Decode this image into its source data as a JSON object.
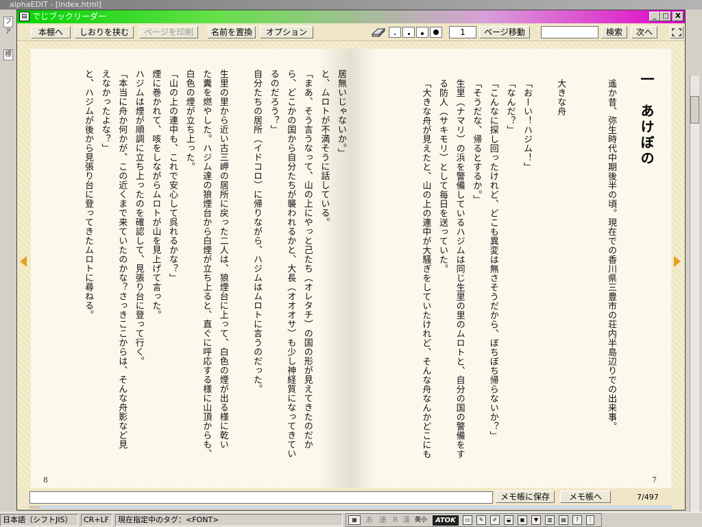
{
  "background_editor": {
    "title": "alphaEDIT - [index.html]",
    "left_marks": [
      "ファ",
      "標"
    ]
  },
  "window": {
    "title": "でじブックリーダー",
    "controls": {
      "minimize": "_",
      "maximize": "□",
      "close": "X"
    }
  },
  "toolbar": {
    "bookshelf": "本棚へ",
    "bookmark": "しおりを挟む",
    "print": "ページを印刷",
    "replace_name": "名前を置換",
    "options": "オプション",
    "page_input": "1",
    "page_move": "ページ移動",
    "search_input": "",
    "search": "検索",
    "next": "次へ",
    "dot_sizes": [
      "・",
      "・",
      "•",
      "●"
    ]
  },
  "book": {
    "right_page": {
      "number": "7",
      "chapter_title": "一　あけぼの",
      "lines": [
        "遙か昔、弥生時代中期後半の頃。現在での香川県三豊市の荘内半島辺りでの出来事。",
        "",
        "",
        "大きな舟",
        "",
        "「おーい！ハジム！」",
        "「なんだ？」",
        "「こんなに探し回ったけれど、どこも異変は無さそうだから、ぼちぼち帰らないか？」",
        "「そうだな、帰るとするか。」",
        "生里（ナマリ）の浜を警備しているハジムは同じ生里の里のムロトと、自分の国の警備をす",
        "る防人（サキモリ）として毎日を送っていた。",
        "「大きな舟が見えたと、山の上の連中が大騒ぎをしていたけれど、そんな舟なんかどこにも"
      ]
    },
    "left_page": {
      "number": "8",
      "lines": [
        "居無いじゃないか。」",
        "と、ムロトが不満そうに話している。",
        "「まあ、そう言うなって、山の上にやっと己たち（オレタチ）の国の形が見えてきたのだか",
        "ら、どこかの国から自分たちが襲われるかと、大長（オオオサ）も少し神経質になってきてい",
        "るのだろう？」",
        "自分たちの居所（イドコロ）に帰りながら、ハジムはムロトに言うのだった。",
        "",
        "生里の里から近い古三岬の居所に戻った二人は、狼煙台に上って、白色の煙が出る様に乾い",
        "た糞を燃やした。ハジム達の狼煙台から白煙が立ち上ると、直ぐに呼応する様に山頂からも、",
        "白色の煙が立ち上った。",
        "「山の上の連中も、これで安心して呉れるかな？」",
        "煙に巻かれて、咳をしながらムロトが山を見上げて言った。",
        "ハジムは煙が順調に立ち上ったのを確認して、見張り台に登って行く。",
        "「本当に舟か何かが、この近くまで来ていたのかな？さっきここからは、そんな舟影など見",
        "えなかったよな？」",
        "と、ハジムが後から見張り台に登ってきたムロトに尋ねる。"
      ]
    }
  },
  "memo": {
    "input": "",
    "save": "メモ帳に保存",
    "open": "メモ帳へ",
    "page_counter": "7/497",
    "progress_fraction": 0.014
  },
  "statusbar": {
    "encoding": "日本語（シフトJIS）",
    "line_ending": "CR+LF",
    "tag": "現在指定中のタグ：<FONT>",
    "ime_keys": [
      "あ",
      "連",
      "R",
      "漢",
      "英小"
    ],
    "ime_brand": "ATOK"
  },
  "colors": {
    "arrow": "#e8a020",
    "title_green": "#00d400",
    "title_magenta": "#e000c8"
  }
}
